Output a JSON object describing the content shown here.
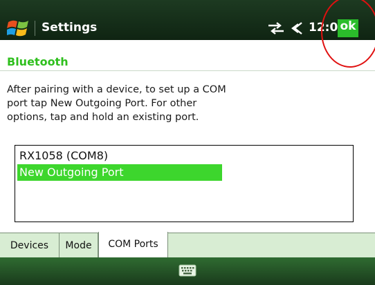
{
  "title_bar": {
    "app_title": "Settings",
    "time": "12:01",
    "ok_label": "ok",
    "icons": [
      "windows-logo-icon",
      "sync-icon",
      "speaker-icon"
    ]
  },
  "section": {
    "title": "Bluetooth"
  },
  "description": "After pairing with a device, to set up a COM\nport tap New Outgoing Port. For other\noptions, tap and hold an existing port.",
  "port_list": {
    "items": [
      {
        "label": "RX1058 (COM8)",
        "selected": false
      },
      {
        "label": "New Outgoing Port",
        "selected": true
      }
    ]
  },
  "tabs": [
    {
      "label": "Devices",
      "active": false
    },
    {
      "label": "Mode",
      "active": false
    },
    {
      "label": "COM Ports",
      "active": true
    }
  ],
  "bottom_bar": {
    "icon": "keyboard-icon"
  },
  "colors": {
    "accent_green": "#3dd62d",
    "title_bar_bg": "#1d3a21",
    "annotation_red": "#e01010"
  }
}
